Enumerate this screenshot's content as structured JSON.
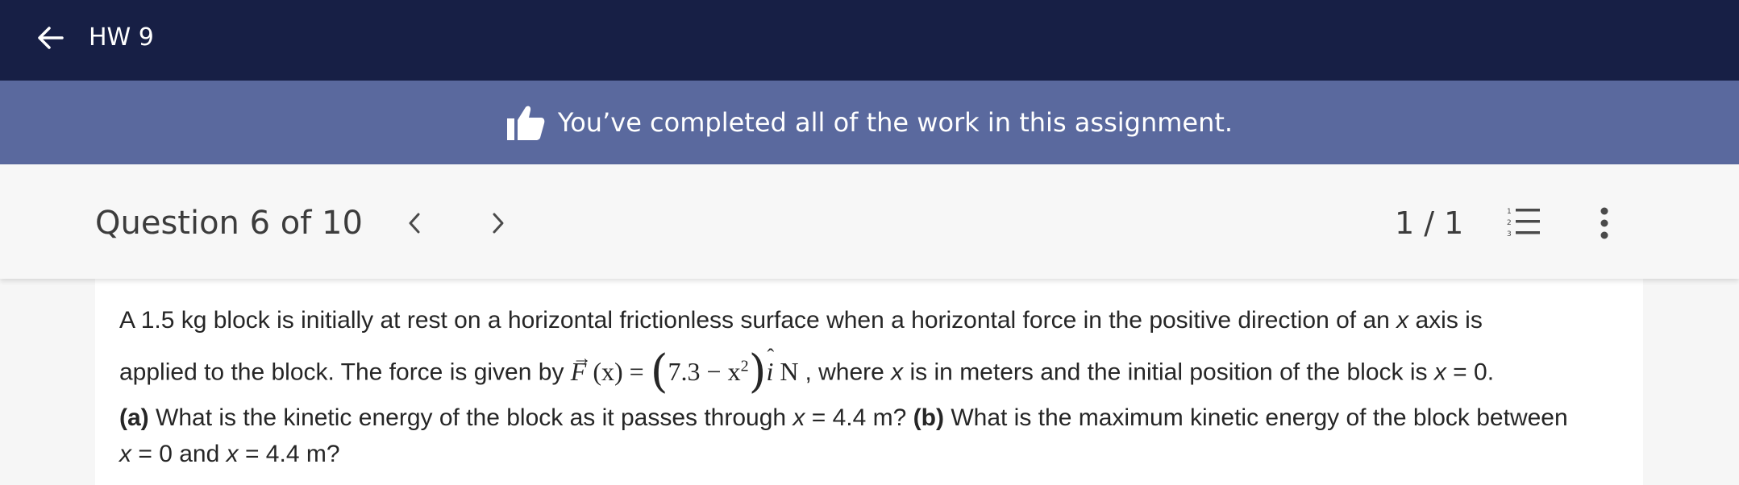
{
  "topbar": {
    "back_icon": "arrow-left-icon",
    "title": "HW 9"
  },
  "banner": {
    "icon": "thumbs-up-icon",
    "message": "You’ve completed all of the work in this assignment."
  },
  "question_bar": {
    "title": "Question 6 of 10",
    "prev_icon": "chevron-left-icon",
    "next_icon": "chevron-right-icon",
    "page_count": "1 / 1",
    "list_icon": "numbered-list-icon",
    "more_icon": "more-vertical-icon"
  },
  "question": {
    "l1_a": "A 1.5 kg block is initially at rest on a horizontal frictionless surface when a horizontal force in the positive direction of an ",
    "l1_x": "x",
    "l1_b": " axis is",
    "l2_a": "applied to the block. The force is given by ",
    "eq_F": "F",
    "eq_arg": " (x) = ",
    "eq_c": "7.3 − x",
    "eq_exp": "2",
    "eq_i": "i",
    "eq_unit": " N ",
    "l2_b": ", where ",
    "l2_x": "x",
    "l2_c": " is in meters and the initial position of the block is ",
    "l2_x2": "x",
    "l2_d": " = 0.",
    "l3_a_label": "(a)",
    "l3_a": " What is the kinetic energy of the block as it passes through ",
    "l3_x": "x",
    "l3_b": " = 4.4 m? ",
    "l3_b_label": "(b)",
    "l3_c": " What is the maximum kinetic energy of the block between",
    "l4_x": "x",
    "l4_a": " = 0 and ",
    "l4_x2": "x",
    "l4_b": " = 4.4 m?"
  },
  "colors": {
    "topbar": "#171f45",
    "banner": "#5a699e",
    "question_bar": "#f7f7f7",
    "content": "#ffffff"
  }
}
